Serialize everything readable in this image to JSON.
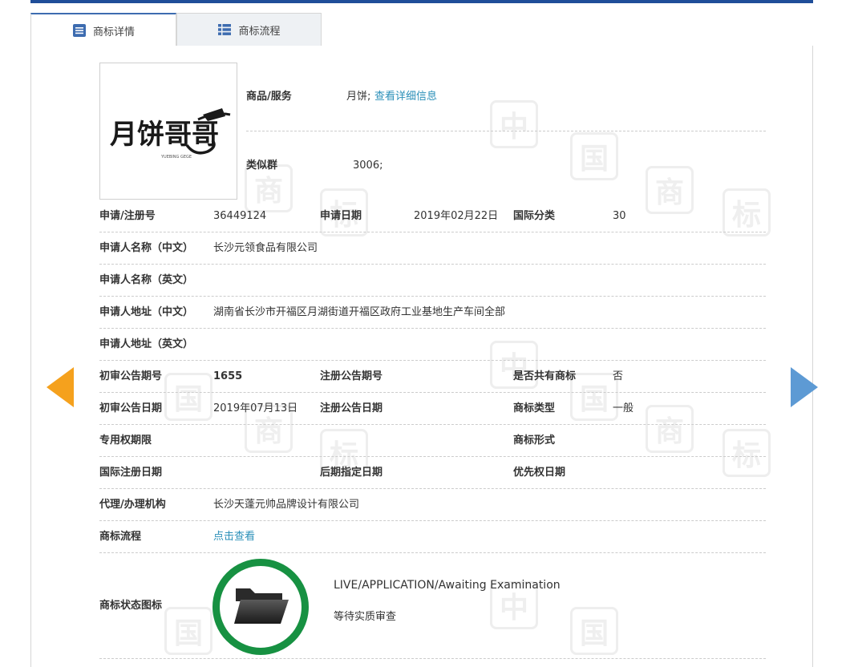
{
  "tabs": [
    {
      "label": "商标详情",
      "icon": "document-icon"
    },
    {
      "label": "商标流程",
      "icon": "list-icon"
    }
  ],
  "logo": {
    "text": "月饼哥哥",
    "subtext": "YUEBING GEGE"
  },
  "goods": {
    "label": "商品/服务",
    "value": "月饼;",
    "link": "查看详细信息"
  },
  "similar": {
    "label": "类似群",
    "value": "3006;"
  },
  "fields": {
    "reg_no_label": "申请/注册号",
    "reg_no": "36449124",
    "apply_date_label": "申请日期",
    "apply_date": "2019年02月22日",
    "intl_class_label": "国际分类",
    "intl_class": "30",
    "applicant_cn_label": "申请人名称（中文）",
    "applicant_cn": "长沙元领食品有限公司",
    "applicant_en_label": "申请人名称（英文）",
    "applicant_en": "",
    "address_cn_label": "申请人地址（中文）",
    "address_cn": "湖南省长沙市开福区月湖街道开福区政府工业基地生产车间全部",
    "address_en_label": "申请人地址（英文）",
    "address_en": "",
    "prelim_no_label": "初审公告期号",
    "prelim_no": "1655",
    "reg_pub_no_label": "注册公告期号",
    "reg_pub_no": "",
    "shared_label": "是否共有商标",
    "shared": "否",
    "prelim_date_label": "初审公告日期",
    "prelim_date": "2019年07月13日",
    "reg_pub_date_label": "注册公告日期",
    "reg_pub_date": "",
    "mark_type_label": "商标类型",
    "mark_type": "一般",
    "exclusive_label": "专用权期限",
    "exclusive": "",
    "mark_form_label": "商标形式",
    "mark_form": "",
    "intl_reg_label": "国际注册日期",
    "intl_reg": "",
    "later_label": "后期指定日期",
    "later": "",
    "priority_label": "优先权日期",
    "priority": "",
    "agent_label": "代理/办理机构",
    "agent": "长沙天蓬元帅品牌设计有限公司",
    "flow_label": "商标流程",
    "flow_link": "点击查看",
    "status_label": "商标状态图标"
  },
  "status": {
    "en": "LIVE/APPLICATION/Awaiting Examination",
    "cn": "等待实质审查",
    "ring_color": "#179142",
    "icon": "folder-icon"
  },
  "watermark_chars": [
    "中",
    "国",
    "商",
    "标"
  ],
  "colors": {
    "accent": "#1f4e99",
    "link": "#2a8fb8",
    "prev_arrow": "#f5a11d",
    "next_arrow": "#5d9ad4"
  }
}
